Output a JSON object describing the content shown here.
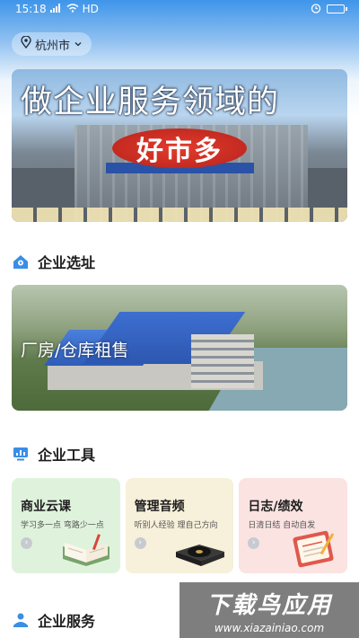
{
  "status_bar": {
    "time": "15:18",
    "network": "HD"
  },
  "location": {
    "city": "杭州市"
  },
  "banner": {
    "headline": "做企业服务领域的",
    "sign_text": "好市多"
  },
  "sections": {
    "site_selection": "企业选址",
    "tools": "企业工具",
    "services": "企业服务"
  },
  "site_card": {
    "caption": "厂房/仓库租售"
  },
  "tool_cards": [
    {
      "title": "商业云课",
      "subtitle": "学习多一点 弯路少一点"
    },
    {
      "title": "管理音频",
      "subtitle": "听别人经验 理自己方向"
    },
    {
      "title": "日志/绩效",
      "subtitle": "日清日结 自动自发"
    }
  ],
  "watermark": {
    "title": "下载鸟应用",
    "url": "www.xiazainiao.com"
  },
  "colors": {
    "header_blue": "#3e95ea",
    "card_green": "#dff3dc",
    "card_yellow": "#f7f0da",
    "card_pink": "#fae3e1"
  }
}
